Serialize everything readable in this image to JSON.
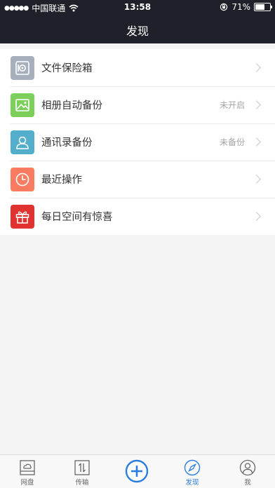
{
  "status_bar": {
    "signal": "●●●●●",
    "carrier": "中国联通",
    "time": "13:58",
    "battery_percent": "71%",
    "battery_level": 0.71
  },
  "nav": {
    "title": "发现"
  },
  "items": [
    {
      "label": "文件保险箱",
      "status": "",
      "icon": "safe-icon",
      "color": "#a6b0bd"
    },
    {
      "label": "相册自动备份",
      "status": "未开启",
      "icon": "photo-icon",
      "color": "#7bcf5a"
    },
    {
      "label": "通讯录备份",
      "status": "未备份",
      "icon": "contact-icon",
      "color": "#52aecb"
    },
    {
      "label": "最近操作",
      "status": "",
      "icon": "clock-icon",
      "color": "#f97c62"
    },
    {
      "label": "每日空间有惊喜",
      "status": "",
      "icon": "gift-icon",
      "color": "#e0322e"
    }
  ],
  "tabs": [
    {
      "label": "网盘",
      "icon": "cloud-disk-icon",
      "active": false
    },
    {
      "label": "传输",
      "icon": "transfer-icon",
      "active": false
    },
    {
      "label": "",
      "icon": "plus-icon",
      "active": false
    },
    {
      "label": "发现",
      "icon": "compass-icon",
      "active": true
    },
    {
      "label": "我",
      "icon": "profile-icon",
      "active": false
    }
  ],
  "colors": {
    "accent": "#2a7de1",
    "nav_bg": "#1e2129"
  }
}
